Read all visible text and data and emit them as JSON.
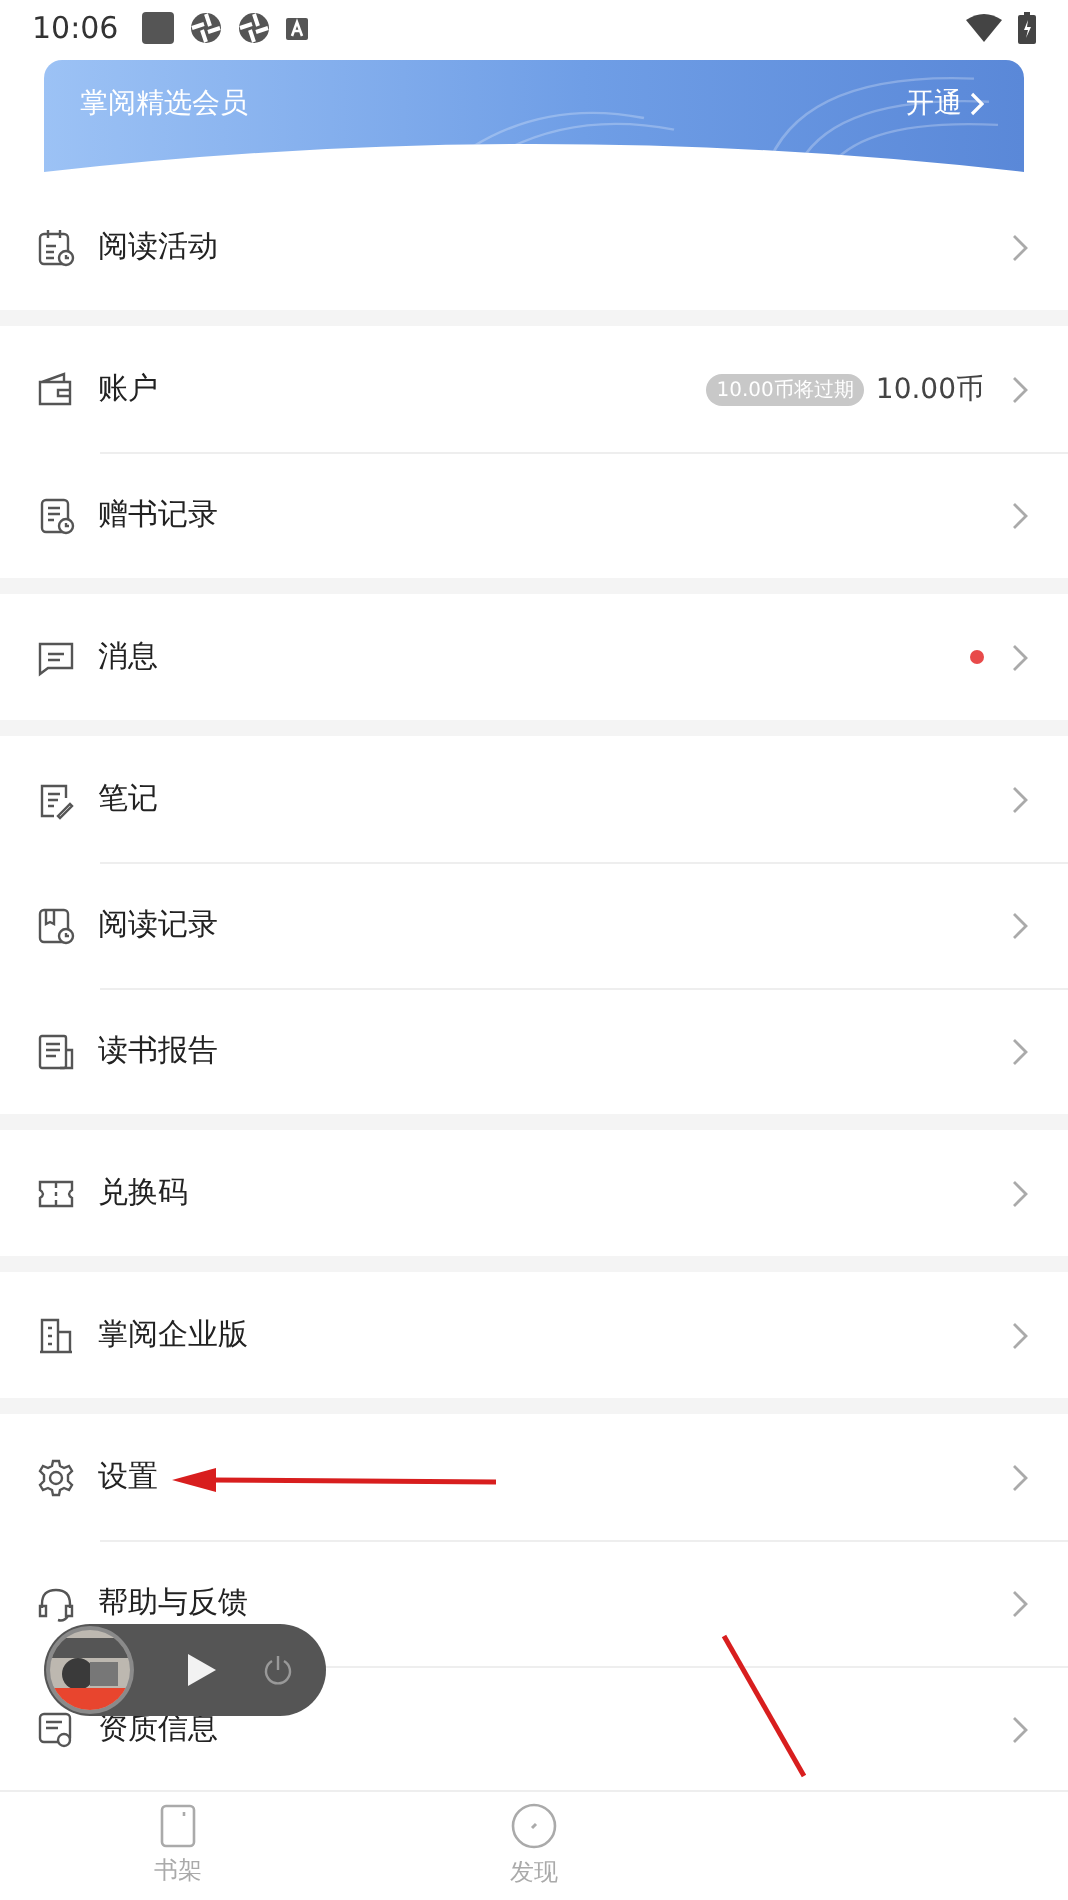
{
  "status_bar": {
    "time": "10:06"
  },
  "banner": {
    "title": "掌阅精选会员",
    "action": "开通"
  },
  "menu_groups": [
    {
      "items": [
        {
          "label": "阅读活动"
        }
      ]
    },
    {
      "items": [
        {
          "label": "账户",
          "badge": "10.00币将过期",
          "value": "10.00币"
        },
        {
          "label": "赠书记录"
        }
      ]
    },
    {
      "items": [
        {
          "label": "消息",
          "unread": true
        }
      ]
    },
    {
      "items": [
        {
          "label": "笔记"
        },
        {
          "label": "阅读记录"
        },
        {
          "label": "读书报告"
        }
      ]
    },
    {
      "items": [
        {
          "label": "兑换码"
        }
      ]
    },
    {
      "items": [
        {
          "label": "掌阅企业版"
        }
      ]
    },
    {
      "items": [
        {
          "label": "设置"
        },
        {
          "label": "帮助与反馈"
        },
        {
          "label": "资质信息"
        }
      ]
    }
  ],
  "bottom_nav": [
    {
      "label": "书架"
    },
    {
      "label": "发现"
    }
  ]
}
